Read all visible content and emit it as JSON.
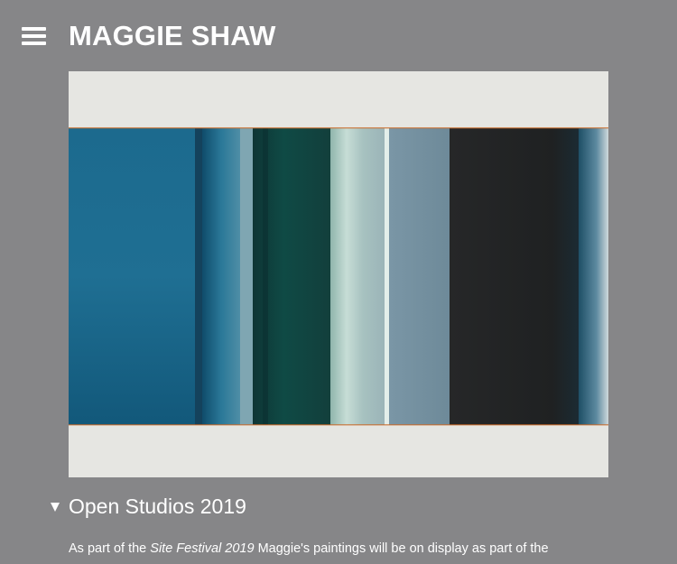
{
  "header": {
    "site_title": "MAGGIE SHAW",
    "menu_icon": "hamburger-menu-icon"
  },
  "artwork": {
    "subject": "abstract painting of vertical color bands"
  },
  "section": {
    "title": "Open Studios 2019",
    "expanded": true,
    "text_before": "As part of the ",
    "text_emphasis": "Site Festival 2019",
    "text_after": " Maggie's paintings will be on display as part of the"
  },
  "colors": {
    "background": "#868688",
    "text": "#ffffff"
  }
}
